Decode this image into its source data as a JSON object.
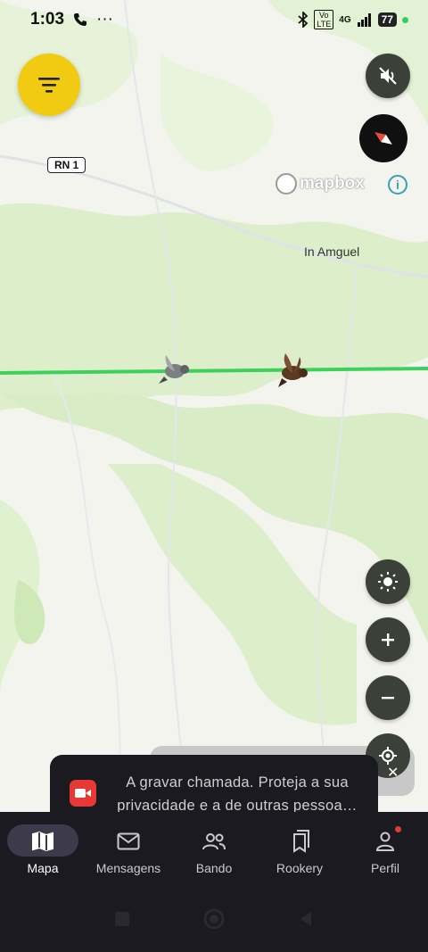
{
  "status_bar": {
    "time": "1:03",
    "call_icon": "phone-icon",
    "more": "···",
    "network": "4G",
    "volte": "Vo LTE",
    "battery": "77"
  },
  "map": {
    "road_badge": "RN 1",
    "place_label": "In Amguel",
    "attribution": "mapbox"
  },
  "toast": {
    "message": "A gravar chamada. Proteja a sua privacidade e a de outras pessoa…",
    "close": "✕"
  },
  "nav": {
    "items": [
      {
        "label": "Mapa",
        "icon": "map-icon"
      },
      {
        "label": "Mensagens",
        "icon": "mail-icon"
      },
      {
        "label": "Bando",
        "icon": "group-icon"
      },
      {
        "label": "Rookery",
        "icon": "bookmarks-icon"
      },
      {
        "label": "Perfil",
        "icon": "person-icon"
      }
    ]
  },
  "colors": {
    "accent": "#f1cb11",
    "route": "#3dd15b",
    "nav_bg": "#1b1a20"
  }
}
